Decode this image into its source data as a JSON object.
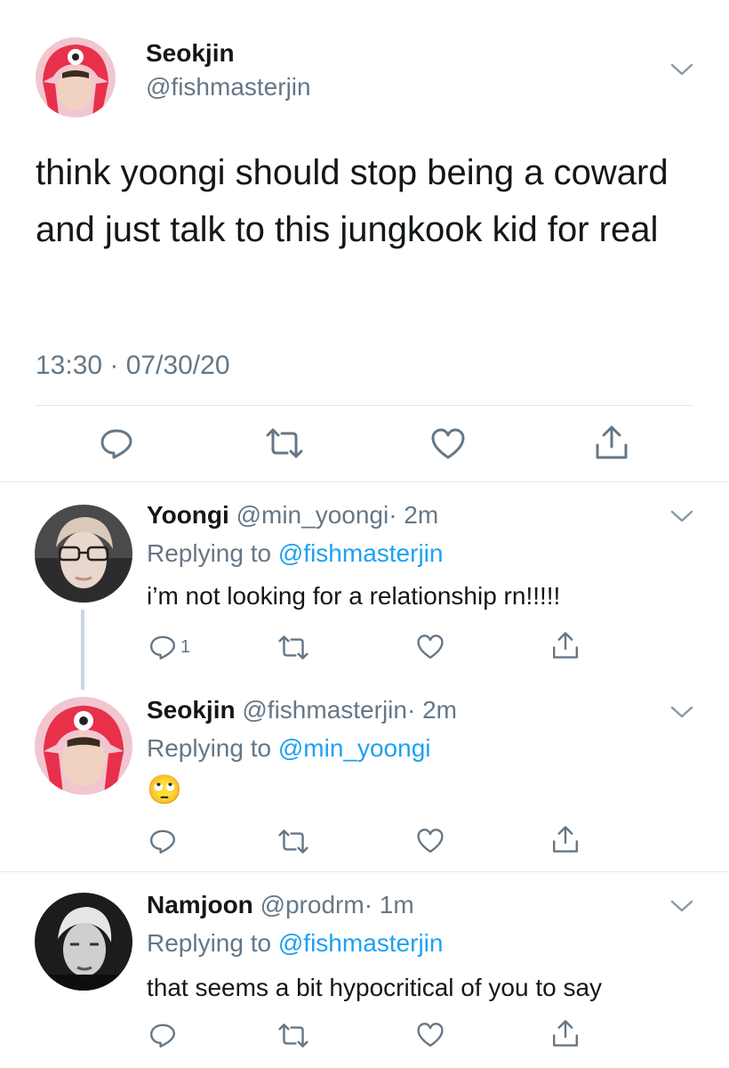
{
  "main_tweet": {
    "name": "Seokjin",
    "handle": "@fishmasterjin",
    "text": "think yoongi should stop being a coward and just talk to this jungkook kid for real",
    "timestamp": "13:30 · 07/30/20",
    "actions": [
      "reply-icon",
      "retweet-icon",
      "like-icon",
      "share-icon"
    ]
  },
  "replies": [
    {
      "name": "Yoongi",
      "handle": "@min_yoongi",
      "time": "· 2m",
      "replying_prefix": "Replying to",
      "replying_to": "@fishmasterjin",
      "text": "i’m not looking for a relationship rn!!!!!",
      "reply_count": "1"
    },
    {
      "name": "Seokjin",
      "handle": "@fishmasterjin",
      "time": "· 2m",
      "replying_prefix": "Replying to",
      "replying_to": "@min_yoongi",
      "text": "🙄"
    },
    {
      "name": "Namjoon",
      "handle": "@prodrm",
      "time": "· 1m",
      "replying_prefix": "Replying to",
      "replying_to": "@fishmasterjin",
      "text": "that seems a bit hypocritical of you to say"
    }
  ],
  "colors": {
    "link": "#1da1f2",
    "muted": "#657786",
    "text": "#14171a",
    "divider": "#e1e8ed"
  }
}
